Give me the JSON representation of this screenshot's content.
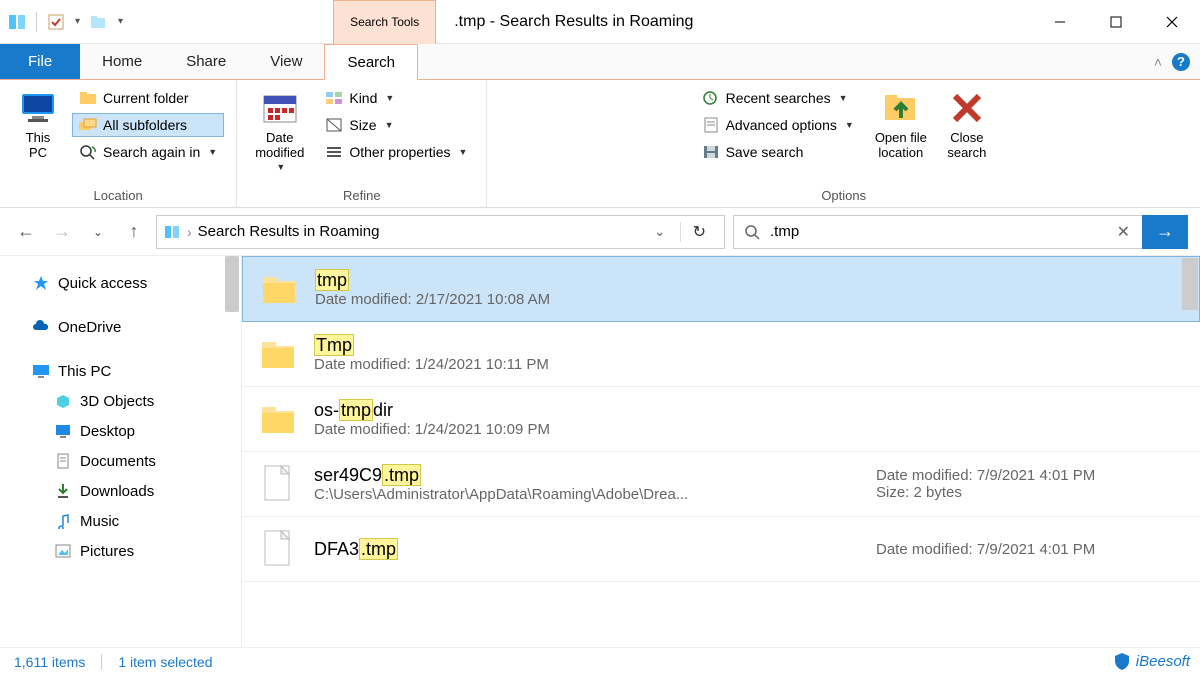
{
  "title": ".tmp - Search Results in Roaming",
  "search_tools_label": "Search Tools",
  "tabs": {
    "file": "File",
    "home": "Home",
    "share": "Share",
    "view": "View",
    "search": "Search"
  },
  "ribbon": {
    "location": {
      "label": "Location",
      "this_pc": "This\nPC",
      "current_folder": "Current folder",
      "all_subfolders": "All subfolders",
      "search_again_in": "Search again in"
    },
    "refine": {
      "label": "Refine",
      "date_modified": "Date\nmodified",
      "kind": "Kind",
      "size": "Size",
      "other_properties": "Other properties"
    },
    "options": {
      "label": "Options",
      "recent_searches": "Recent searches",
      "advanced_options": "Advanced options",
      "save_search": "Save search",
      "open_file_location": "Open file\nlocation",
      "close_search": "Close\nsearch"
    }
  },
  "address": {
    "crumb": "Search Results in Roaming"
  },
  "search": {
    "value": ".tmp"
  },
  "sidebar": {
    "quick_access": "Quick access",
    "onedrive": "OneDrive",
    "this_pc": "This PC",
    "objects3d": "3D Objects",
    "desktop": "Desktop",
    "documents": "Documents",
    "downloads": "Downloads",
    "music": "Music",
    "pictures": "Pictures"
  },
  "results": [
    {
      "name_pre": "",
      "name_hl": "tmp",
      "name_post": "",
      "sub_label": "Date modified:",
      "sub_value": "2/17/2021 10:08 AM",
      "meta1": "",
      "meta2": "",
      "type": "folder",
      "selected": true
    },
    {
      "name_pre": "",
      "name_hl": "Tmp",
      "name_post": "",
      "sub_label": "Date modified:",
      "sub_value": "1/24/2021 10:11 PM",
      "meta1": "",
      "meta2": "",
      "type": "folder",
      "selected": false
    },
    {
      "name_pre": "os-",
      "name_hl": "tmp",
      "name_post": "dir",
      "sub_label": "Date modified:",
      "sub_value": "1/24/2021 10:09 PM",
      "meta1": "",
      "meta2": "",
      "type": "folder",
      "selected": false
    },
    {
      "name_pre": "ser49C9",
      "name_hl": ".tmp",
      "name_post": "",
      "sub_label": "",
      "sub_value": "C:\\Users\\Administrator\\AppData\\Roaming\\Adobe\\Drea...",
      "meta1_label": "Date modified:",
      "meta1": "7/9/2021 4:01 PM",
      "meta2_label": "Size:",
      "meta2": "2 bytes",
      "type": "file",
      "selected": false
    },
    {
      "name_pre": "DFA3",
      "name_hl": ".tmp",
      "name_post": "",
      "sub_label": "",
      "sub_value": "",
      "meta1_label": "Date modified:",
      "meta1": "7/9/2021 4:01 PM",
      "meta2_label": "",
      "meta2": "",
      "type": "file",
      "selected": false
    }
  ],
  "status": {
    "items": "1,611 items",
    "selected": "1 item selected"
  },
  "watermark": "iBeesoft"
}
